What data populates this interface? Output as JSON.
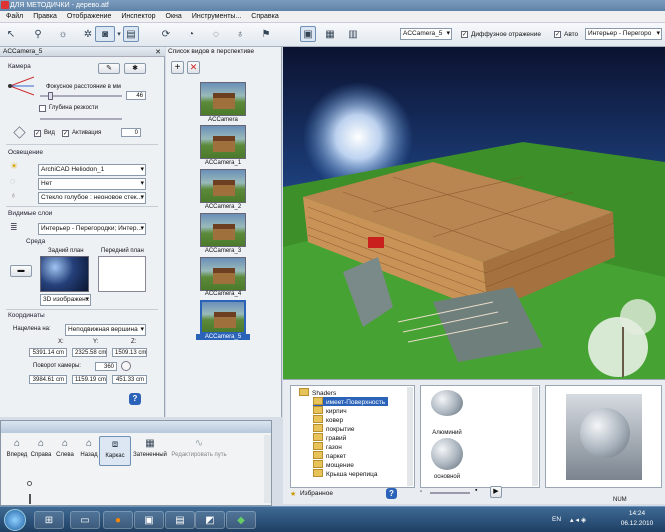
{
  "window": {
    "title": "ДЛЯ МЕТОДИЧКИ - дерево.atf"
  },
  "menu": [
    "Файл",
    "Правка",
    "Отображение",
    "Инспектор",
    "Окна",
    "Инструменты...",
    "Справка"
  ],
  "toolbar": {
    "camera_select": "ACCamera_5",
    "diffuse_checked": true,
    "diffuse_label": "Диффузное отражение",
    "auto_checked": true,
    "auto_label": "Авто",
    "style_select": "Интерьер - Перегоро"
  },
  "left_panel": {
    "header": "ACCamera_5",
    "camera": {
      "title": "Камера",
      "focal_label": "Фокусное расстояние в мм",
      "focal_value": "46",
      "dof_label": "Глубина резкости",
      "dof_checked": false,
      "view_label": "Вид",
      "view_checked": true,
      "activation_label": "Активация",
      "activation_checked": true,
      "zero_value": "0"
    },
    "lighting": {
      "title": "Освещение",
      "light_select": "ArchiCAD Heliodon_1",
      "second_select": "Нет",
      "glass_select": "Стекло голубое : неоновое стек..."
    },
    "layers": {
      "title": "Видимые слои",
      "layer_select": "Интерьер - Перегородки; Интер..."
    },
    "environment": {
      "title": "Среда",
      "background_label": "Задний план",
      "foreground_label": "Передний план",
      "image_select": "3D изображен..."
    },
    "coords": {
      "title": "Координаты",
      "aim_label": "Нацелена на:",
      "aim_select": "Неподвижная вершина",
      "x_label": "X:",
      "y_label": "Y:",
      "z_label": "Z:",
      "x1": "5391.14 cm",
      "y1": "2325.58 cm",
      "z1": "1509.13 cm",
      "rotation_label": "Поворот камеры:",
      "rotation_value": "360",
      "x2": "3984.61 cm",
      "y2": "1159.19 cm",
      "z2": "451.33 cm"
    }
  },
  "camera_list": {
    "header": "Список видов в перспективе",
    "items": [
      "ACCamera",
      "ACCamera_1",
      "ACCamera_2",
      "ACCamera_3",
      "ACCamera_4",
      "ACCamera_5"
    ],
    "selected_index": 5
  },
  "shaders": {
    "root": "Shaders",
    "items": [
      "имеет-Поверхность",
      "кирпич",
      "ковер",
      "покрытие",
      "гравий",
      "газон",
      "паркет",
      "мощение",
      "Крыша черепица"
    ],
    "selected_index": 0,
    "favorites_label": "Избранное"
  },
  "preview": {
    "labels": [
      "Алюминий",
      "основной"
    ]
  },
  "nav_window": {
    "buttons": [
      "Вперед",
      "Справа",
      "Слева",
      "Назад",
      "Каркас",
      "Затененный",
      "Редактировать путь"
    ],
    "active_index": 4
  },
  "taskbar": {
    "lang": "EN",
    "time": "14:24",
    "date": "06.12.2010",
    "num_label": "NUM"
  },
  "colors": {
    "accent": "#3f6a94",
    "sky_top": "#0b1230",
    "grass": "#3d8f2a"
  }
}
